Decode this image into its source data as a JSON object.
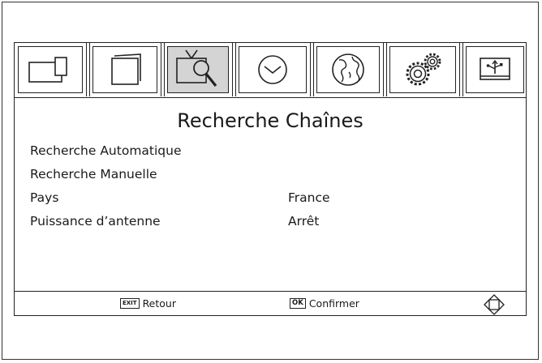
{
  "tabs": [
    {
      "icon": "picture-icon"
    },
    {
      "icon": "sound-icon"
    },
    {
      "icon": "channel-search-icon",
      "active": true
    },
    {
      "icon": "clock-icon"
    },
    {
      "icon": "globe-icon"
    },
    {
      "icon": "gears-icon"
    },
    {
      "icon": "usb-icon"
    }
  ],
  "menu": {
    "title": "Recherche Chaînes",
    "items": [
      {
        "label": "Recherche Automatique",
        "value": ""
      },
      {
        "label": "Recherche Manuelle",
        "value": ""
      },
      {
        "label": "Pays",
        "value": "France"
      },
      {
        "label": "Puissance d’antenne",
        "value": "Arrêt"
      }
    ]
  },
  "footer": {
    "exit_key": "EXIT",
    "exit_label": "Retour",
    "ok_key": "OK",
    "ok_label": "Confirmer",
    "nav_icon": "dpad-arrows-icon"
  },
  "colors": {
    "active_tab": "#d4d4d4",
    "line": "#222222"
  }
}
